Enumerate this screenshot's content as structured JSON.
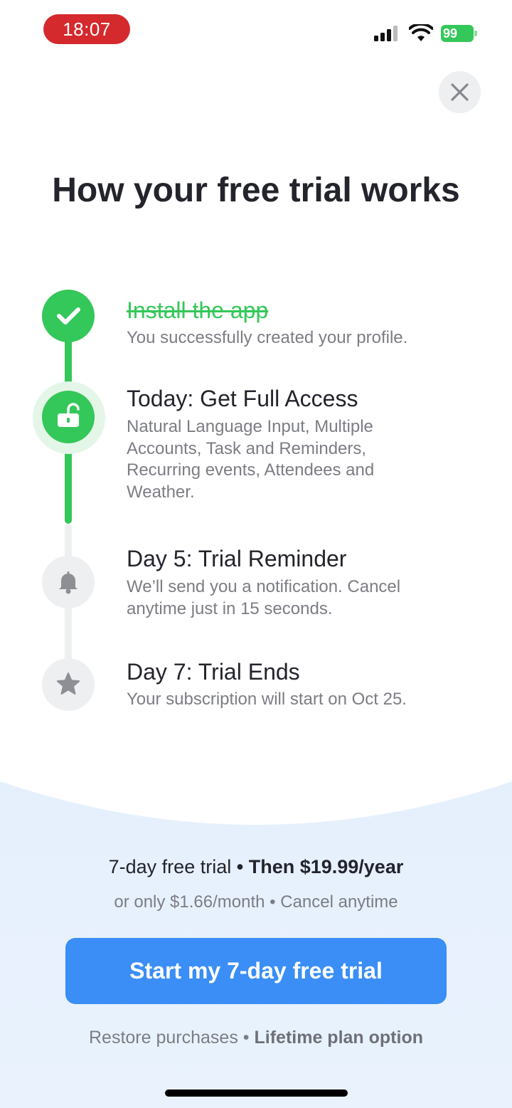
{
  "status_bar": {
    "time": "18:07",
    "battery": "99",
    "time_pill_color": "#d42a2e",
    "battery_color": "#34c759"
  },
  "close_icon": "close-icon",
  "title": "How your free trial works",
  "steps": [
    {
      "title": "Install the app",
      "description": "You successfully created your profile.",
      "icon": "checkmark-icon",
      "state": "completed"
    },
    {
      "title": "Today: Get Full Access",
      "description": "Natural Language Input, Multiple Accounts, Task and Reminders, Recurring events, Attendees and Weather.",
      "icon": "unlock-icon",
      "state": "current"
    },
    {
      "title": "Day 5: Trial Reminder",
      "description": "We’ll send you a notification. Cancel anytime just in 15 seconds.",
      "icon": "bell-icon",
      "state": "upcoming"
    },
    {
      "title": "Day 7: Trial Ends",
      "description": "Your subscription will start on Oct 25.",
      "icon": "star-icon",
      "state": "upcoming"
    }
  ],
  "pricing": {
    "trial_text": "7-day free trial",
    "separator": "•",
    "price_text": "Then $19.99/year",
    "monthly_text": "or only $1.66/month",
    "sub_separator": "•",
    "cancel_text": "Cancel anytime"
  },
  "cta_label": "Start my 7-day free trial",
  "footer": {
    "restore_label": "Restore purchases",
    "separator": "•",
    "lifetime_label": "Lifetime plan option"
  },
  "colors": {
    "accent_green": "#34c759",
    "cta_blue": "#3a8ef6",
    "bottom_panel": "#e7f1fd",
    "text_dark": "#23242c",
    "text_muted": "#7c7d84"
  }
}
